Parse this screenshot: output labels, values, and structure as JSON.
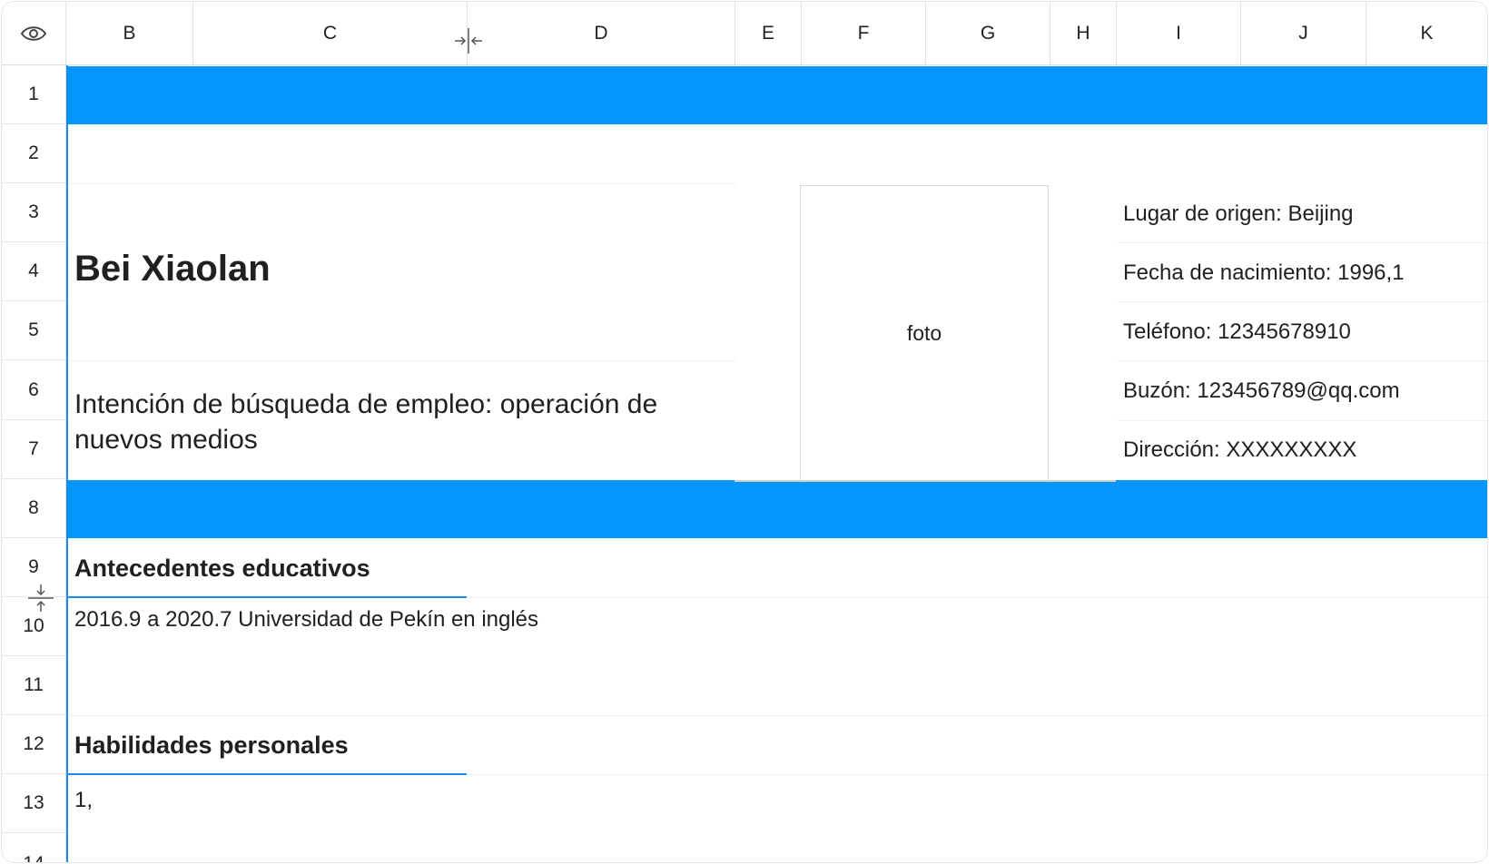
{
  "columns": [
    "B",
    "C",
    "D",
    "E",
    "F",
    "G",
    "H",
    "I",
    "J",
    "K"
  ],
  "rows": [
    "1",
    "2",
    "3",
    "4",
    "5",
    "6",
    "7",
    "8",
    "9",
    "10",
    "11",
    "12",
    "13",
    "14"
  ],
  "accent_color": "#0396ff",
  "resume": {
    "name": "Bei Xiaolan",
    "intent": "Intención de búsqueda de empleo: operación de nuevos medios",
    "photo_label": "foto",
    "info": {
      "origin": "Lugar de origen: Beijing",
      "birth": "Fecha de nacimiento: 1996,1",
      "phone": "Teléfono: 12345678910",
      "mailbox": "Buzón: 123456789@qq.com",
      "address": "Dirección: XXXXXXXXX"
    },
    "education_title": "Antecedentes educativos",
    "education_entry": "2016.9 a 2020.7 Universidad de Pekín en inglés",
    "skills_title": "Habilidades personales",
    "skills_entry": "1,"
  },
  "icons": {
    "visibility": "eye-icon",
    "column_resize": "column-resize-icon",
    "row_resize": "row-resize-icon"
  }
}
